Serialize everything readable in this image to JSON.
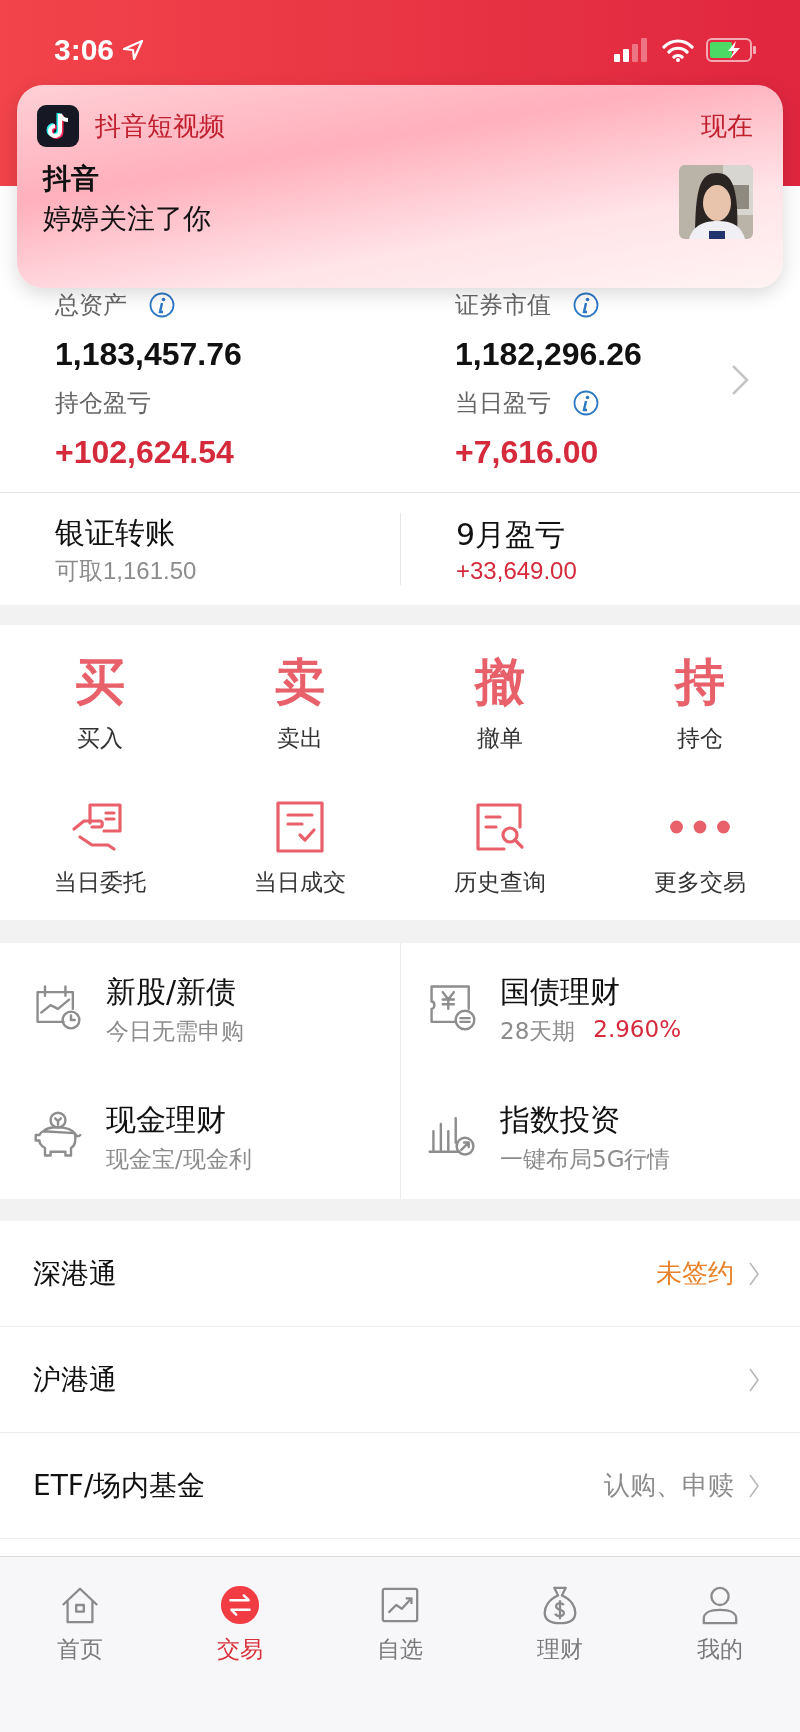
{
  "status_bar": {
    "time": "3:06"
  },
  "notification": {
    "app": "抖音短视频",
    "time": "现在",
    "title": "抖音",
    "body": "婷婷关注了你"
  },
  "summary": {
    "stats": [
      {
        "label": "总资产",
        "info": true,
        "value": "1,183,457.76",
        "color": "#111111"
      },
      {
        "label": "证券市值",
        "info": true,
        "value": "1,182,296.26",
        "color": "#111111"
      },
      {
        "label": "持仓盈亏",
        "info": false,
        "value": "+102,624.54",
        "color": "#d42a3c"
      },
      {
        "label": "当日盈亏",
        "info": true,
        "value": "+7,616.00",
        "color": "#d42a3c"
      }
    ],
    "transfer": {
      "title": "银证转账",
      "detail": "可取1,161.50"
    },
    "monthly": {
      "title": "9月盈亏",
      "value": "+33,649.00"
    }
  },
  "actions": [
    {
      "kind": "glyph",
      "glyph": "买",
      "label": "买入"
    },
    {
      "kind": "glyph",
      "glyph": "卖",
      "label": "卖出"
    },
    {
      "kind": "glyph",
      "glyph": "撤",
      "label": "撤单"
    },
    {
      "kind": "glyph",
      "glyph": "持",
      "label": "持仓"
    },
    {
      "kind": "entrust",
      "label": "当日委托"
    },
    {
      "kind": "deal",
      "label": "当日成交"
    },
    {
      "kind": "history",
      "label": "历史查询"
    },
    {
      "kind": "more",
      "label": "更多交易"
    }
  ],
  "products": [
    {
      "kind": "calendar",
      "title": "新股/新债",
      "subtitle": "今日无需申购"
    },
    {
      "kind": "ticket",
      "title": "国债理财",
      "subtitle": "28天期",
      "highlight": "2.960%"
    },
    {
      "kind": "piggy",
      "title": "现金理财",
      "subtitle": "现金宝/现金利"
    },
    {
      "kind": "bars",
      "title": "指数投资",
      "subtitle": "一键布局5G行情"
    }
  ],
  "menu": [
    {
      "label": "深港通",
      "status": "未签约",
      "color": "#e8822a"
    },
    {
      "label": "沪港通"
    },
    {
      "label": "ETF/场内基金",
      "status": "认购、申赎",
      "color": "#8c8c8c"
    }
  ],
  "tabs": [
    {
      "kind": "home",
      "label": "首页",
      "selected": false
    },
    {
      "kind": "trade",
      "label": "交易",
      "selected": true
    },
    {
      "kind": "watchlist",
      "label": "自选",
      "selected": false
    },
    {
      "kind": "wealth",
      "label": "理财",
      "selected": false
    },
    {
      "kind": "profile",
      "label": "我的",
      "selected": false
    }
  ]
}
